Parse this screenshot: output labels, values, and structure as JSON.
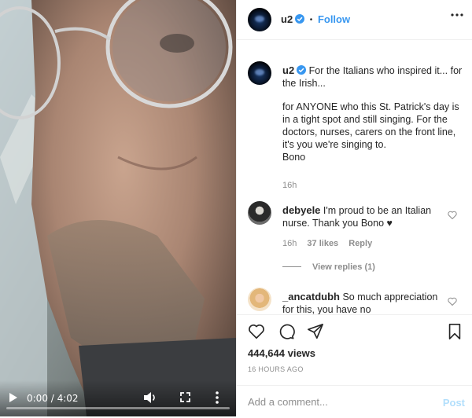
{
  "video": {
    "time": "0:00 / 4:02",
    "progress_fraction": 0,
    "icons": {
      "play": "play-icon",
      "volume": "volume-icon",
      "fullscreen": "fullscreen-icon",
      "more": "more-vertical-icon"
    }
  },
  "header": {
    "username": "u2",
    "separator": "•",
    "follow_label": "Follow",
    "icons": {
      "verified": "verified-badge-icon",
      "more": "more-horizontal-icon"
    }
  },
  "caption": {
    "username": "u2",
    "first_line": "For the Italians who inspired it... for the Irish...",
    "body": "for ANYONE who this St. Patrick's day is in a tight spot and still singing. For the doctors, nurses, carers on the front line, it's you we're singing to.",
    "signature": "Bono",
    "time": "16h"
  },
  "comments": [
    {
      "username": "debyele",
      "text": "I'm proud to be an Italian nurse. Thank you Bono ♥",
      "time": "16h",
      "likes": "37 likes",
      "reply_label": "Reply",
      "view_replies": "View replies (1)"
    },
    {
      "username": "_ancatdubh",
      "text": "So much appreciation for this, you have no"
    }
  ],
  "actions": {
    "views": "444,644 views",
    "timestamp": "16 HOURS AGO",
    "icons": {
      "like": "heart-icon",
      "comment": "comment-icon",
      "share": "share-icon",
      "save": "bookmark-icon"
    }
  },
  "comment_box": {
    "placeholder": "Add a comment...",
    "post_label": "Post"
  },
  "colors": {
    "link_blue": "#3897f0",
    "post_disabled": "#b2dffc",
    "muted": "#8e8e8e",
    "text": "#262626"
  }
}
